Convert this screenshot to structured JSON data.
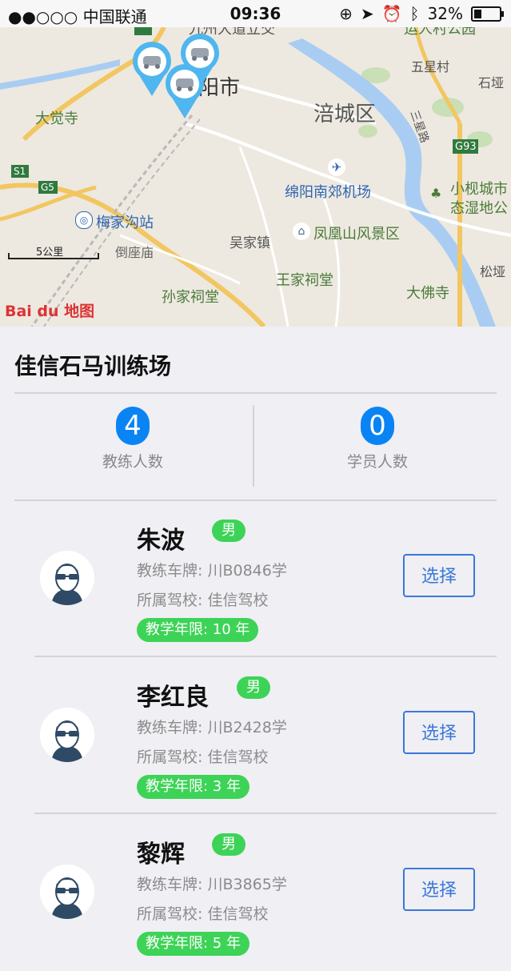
{
  "status_bar": {
    "carrier": "●●○○○ 中国联通",
    "time": "09:36",
    "battery": "32%"
  },
  "map": {
    "labels": {
      "city": "阳市",
      "district": "涪城区",
      "dajue": "大觉寺",
      "wuxing": "五星村",
      "shiya": "石垭",
      "airport": "绵阳南郊机场",
      "meijia": "梅家沟站",
      "daozuo": "倒座庙",
      "wujia": "吴家镇",
      "fenghuang": "凤凰山风景区",
      "wangjia": "王家祠堂",
      "sunjia": "孙家祠堂",
      "dafo": "大佛寺",
      "xiaoshu": "小枧城市",
      "taishidi": "态湿地公",
      "songya": "松垭",
      "sanxing": "三星路",
      "top_road": "九州大道立交",
      "top_park": "运人村公园",
      "g5": "G5",
      "g93": "G93",
      "s1": "S1"
    },
    "scale": "5公里",
    "baidu_logo": "Bai du 地图"
  },
  "site": {
    "title": "佳信石马训练场"
  },
  "stats": [
    {
      "value": "4",
      "label": "教练人数"
    },
    {
      "value": "0",
      "label": "学员人数"
    }
  ],
  "coaches": [
    {
      "name": "朱波",
      "gender": "男",
      "plate": "教练车牌: 川B0846学",
      "school": "所属驾校: 佳信驾校",
      "years": "教学年限: 10 年",
      "action": "选择"
    },
    {
      "name": "李红良",
      "gender": "男",
      "plate": "教练车牌: 川B2428学",
      "school": "所属驾校: 佳信驾校",
      "years": "教学年限: 3 年",
      "action": "选择"
    },
    {
      "name": "黎辉",
      "gender": "男",
      "plate": "教练车牌: 川B3865学",
      "school": "所属驾校: 佳信驾校",
      "years": "教学年限: 5 年",
      "action": "选择"
    }
  ]
}
